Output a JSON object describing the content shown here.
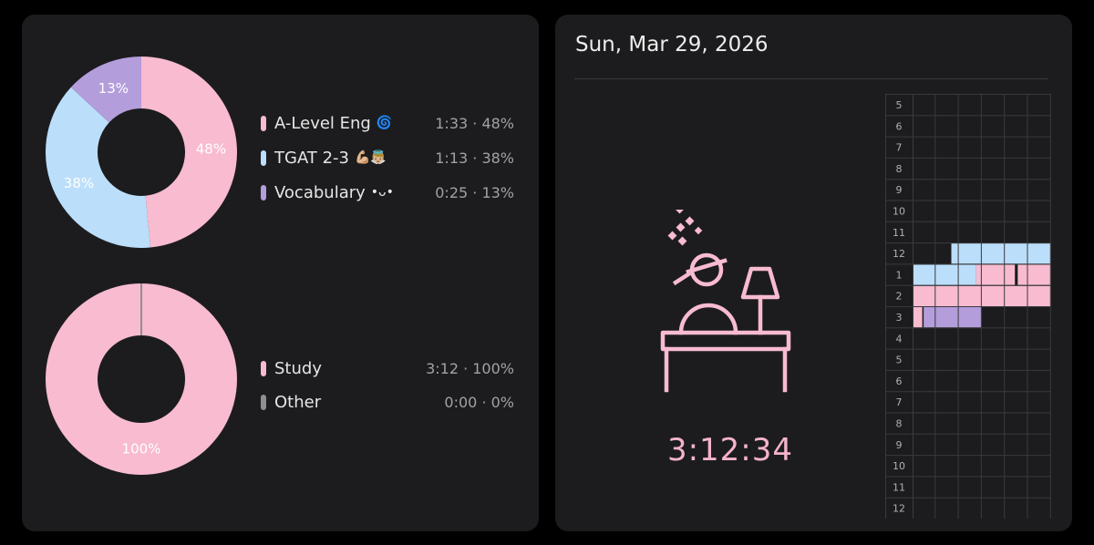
{
  "colors": {
    "pink": "#f8bbd0",
    "light_blue": "#bbdefb",
    "lavender": "#b39ddb",
    "gray": "#8e8e93",
    "card_bg": "#1c1c1e",
    "page_bg": "#000000"
  },
  "subjects": {
    "items": [
      {
        "name": "A-Level Eng",
        "emoji": "🌀",
        "stat": "1:33 · 48%",
        "percent_label": "48%",
        "percent": 48,
        "color": "#f8bbd0"
      },
      {
        "name": "TGAT 2-3",
        "emoji": "💪🏼👼🏼",
        "stat": "1:13 · 38%",
        "percent_label": "38%",
        "percent": 38,
        "color": "#bbdefb"
      },
      {
        "name": "Vocabulary",
        "emoji": "•ᴗ•",
        "stat": "0:25 · 13%",
        "percent_label": "13%",
        "percent": 13,
        "color": "#b39ddb"
      }
    ]
  },
  "categories": {
    "items": [
      {
        "name": "Study",
        "stat": "3:12 · 100%",
        "percent_label": "100%",
        "percent": 100,
        "color": "#f8bbd0"
      },
      {
        "name": "Other",
        "stat": "0:00 · 0%",
        "percent_label": "",
        "percent": 0,
        "color": "#8e8e93"
      }
    ]
  },
  "detail": {
    "date": "Sun, Mar 29, 2026",
    "timer": "3:12:34",
    "illustration_icon": "person-studying-at-desk-icon"
  },
  "timeline": {
    "hour_labels": [
      "5",
      "6",
      "7",
      "8",
      "9",
      "10",
      "11",
      "12",
      "1",
      "2",
      "3",
      "4",
      "5",
      "6",
      "7",
      "8",
      "9",
      "10",
      "11",
      "12"
    ],
    "blocks": [
      {
        "hour": "12",
        "from": 0.28,
        "to": 1.0,
        "color": "#bbdefb"
      },
      {
        "hour": "1",
        "from": 0.0,
        "to": 0.46,
        "color": "#bbdefb"
      },
      {
        "hour": "1",
        "from": 0.46,
        "to": 0.74,
        "color": "#f8bbd0"
      },
      {
        "hour": "1",
        "from": 0.74,
        "to": 0.76,
        "color": "#1c1c1e"
      },
      {
        "hour": "1",
        "from": 0.76,
        "to": 1.0,
        "color": "#f8bbd0"
      },
      {
        "hour": "2",
        "from": 0.0,
        "to": 1.0,
        "color": "#f8bbd0"
      },
      {
        "hour": "3",
        "from": 0.0,
        "to": 0.07,
        "color": "#f8bbd0"
      },
      {
        "hour": "3",
        "from": 0.08,
        "to": 0.5,
        "color": "#b39ddb"
      }
    ]
  }
}
